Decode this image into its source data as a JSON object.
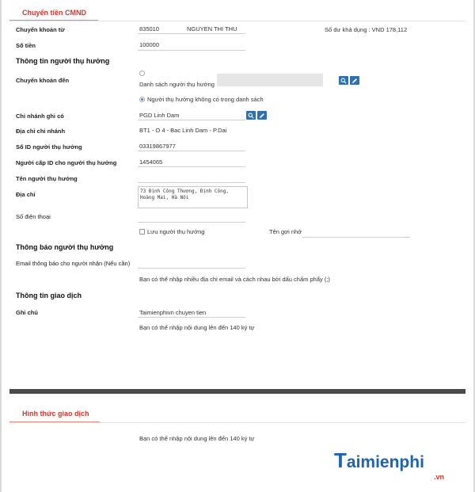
{
  "tab_title": "Chuyển tiền CMND",
  "source_account": {
    "label": "Chuyển khoản từ",
    "account_number": "835010",
    "account_name": "NGUYEN THI THU",
    "balance_text": "Số dư khả dụng : VND 178,112"
  },
  "amount": {
    "label": "Số tiền",
    "value": "100000"
  },
  "beneficiary_section": {
    "title": "Thông tin người thụ hưởng",
    "transfer_to_label": "Chuyển khoản đến",
    "option_list": "Danh sách người thụ hưởng",
    "option_not_in_list": "Người thụ hưởng không có trong danh sách",
    "branch_label": "Chi nhánh ghi có",
    "branch_value": "PGD Linh Dam",
    "branch_address_label": "Địa chỉ chi nhánh",
    "branch_address_value": "BT1 - O 4 - Bac Linh Dam - P.Dai",
    "id_label": "Số ID người thụ hưởng",
    "id_value": "03319867977",
    "id_issuer_label": "Người cấp ID cho người thụ hưởng",
    "id_issuer_value": "1454065",
    "name_label": "Tên người thụ hưởng",
    "name_value": "",
    "address_label": "Địa chỉ",
    "address_value": "73 Định Công Thượng, Định Công,\nHoàng Mai, Hà Nội",
    "phone_label": "Số điện thoại",
    "phone_value": "",
    "save_label": "Lưu người thụ hưởng",
    "nickname_label": "Tên gợi nhớ",
    "nickname_value": ""
  },
  "notify_section": {
    "title": "Thông báo người thụ hưởng",
    "email_label": "Email thông báo cho người nhận (Nếu cần)",
    "email_value": "",
    "email_hint": "Bạn có thể nhập nhiều địa chỉ email và cách nhau bởi dấu chấm phẩy (;)"
  },
  "transaction_section": {
    "title": "Thông tin giao dịch",
    "note_label": "Ghi chú",
    "note_value": "Taimienphivn chuyen tien",
    "note_hint": "Bạn có thể nhập nội dung lên đến 140 ký tự"
  },
  "method_section": {
    "title": "Hình thức giao dịch",
    "hint": "Bạn có thể nhập nội dung lên đến 140 ký tự"
  },
  "watermark": {
    "first": "T",
    "rest": "aimienphi",
    "suffix": ".vn"
  },
  "colors": {
    "accent": "#d9342b",
    "button": "#2f6fb3",
    "divider": "#4a4a4a"
  },
  "icons": {
    "search": "search-icon",
    "edit": "pencil-icon"
  }
}
